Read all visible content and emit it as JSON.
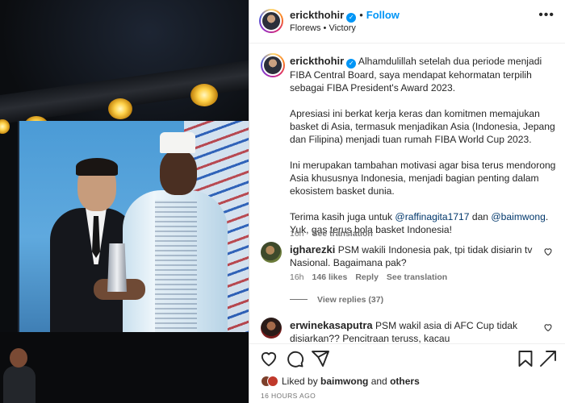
{
  "post": {
    "username": "erickthohir",
    "follow_label": "Follow",
    "location": "Florews • Victory"
  },
  "caption": {
    "username": "erickthohir",
    "p1": "Alhamdulillah setelah dua periode menjadi FIBA Central Board, saya mendapat kehormatan terpilih sebagai FIBA President's Award 2023.",
    "p2": "Apresiasi ini berkat kerja keras dan komitmen memajukan basket di Asia, termasuk menjadikan Asia (Indonesia, Jepang dan Filipina) menjadi tuan rumah FIBA World Cup 2023.",
    "p3": "Ini merupakan tambahan motivasi agar bisa terus mendorong Asia khususnya Indonesia, menjadi bagian penting dalam ekosistem basket dunia.",
    "p4_before": "Terima kasih juga untuk ",
    "mention1": "@raffinagita1717",
    "p4_mid": " dan ",
    "mention2": "@baimwong",
    "p4_after": ". Yuk, gas terus bola basket Indonesia!",
    "age": "16h",
    "see_translation": "See translation"
  },
  "comments": [
    {
      "username": "igharezki",
      "text": "PSM wakili Indonesia pak, tpi tidak disiarin tv Nasional. Bagaimana pak?",
      "age": "16h",
      "likes": "146 likes",
      "reply": "Reply",
      "see_translation": "See translation",
      "view_replies": "View replies (37)"
    },
    {
      "username": "erwinekasaputra",
      "text": "PSM wakil asia di AFC Cup tidak disiarkan?? Pencitraan teruss, kacau"
    }
  ],
  "footer": {
    "liked_by_prefix": "Liked by ",
    "liked_by_user": "baimwong",
    "liked_by_and": " and ",
    "liked_by_others": "others",
    "timestamp": "16 HOURS AGO"
  },
  "icons": {
    "like": "heart-icon",
    "comment": "comment-icon",
    "share": "share-icon",
    "save": "bookmark-icon",
    "more": "more-icon",
    "verified": "verified-badge-icon"
  },
  "colors": {
    "link_blue": "#0095f6",
    "mention": "#00376b",
    "muted": "#737373"
  }
}
